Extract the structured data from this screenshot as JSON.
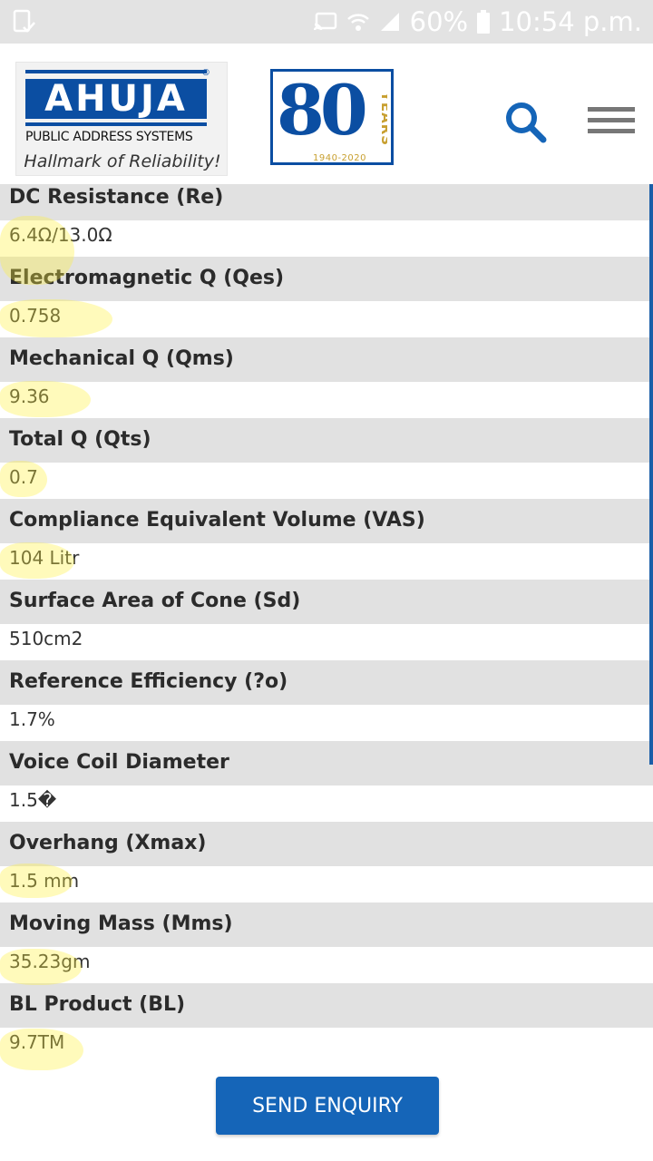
{
  "status_bar": {
    "battery": "60%",
    "time": "10:54 p.m."
  },
  "header": {
    "logo": {
      "name": "AHUJA",
      "registered": "®",
      "subtitle": "PUBLIC ADDRESS SYSTEMS",
      "tagline": "Hallmark of Reliability!"
    },
    "anniversary": {
      "number": "80",
      "word": "YEARS",
      "range": "1940-2020"
    },
    "icons": {
      "search": "search-icon",
      "menu": "hamburger-menu-icon"
    }
  },
  "colors": {
    "brand_blue": "#0b4ea2",
    "button_blue": "#1565b8",
    "label_bg": "#e1e1e1",
    "status_bg": "#e3e3e3",
    "highlight": "#fff03c"
  },
  "specs": [
    {
      "label": "DC Resistance (Re)",
      "value": "6.4Ω/13.0Ω"
    },
    {
      "label": "Electromagnetic Q (Qes)",
      "value": "0.758"
    },
    {
      "label": "Mechanical Q (Qms)",
      "value": "9.36"
    },
    {
      "label": "Total Q (Qts)",
      "value": "0.7"
    },
    {
      "label": "Compliance Equivalent Volume (VAS)",
      "value": "104 Litr"
    },
    {
      "label": "Surface Area of Cone (Sd)",
      "value": "510cm2"
    },
    {
      "label": "Reference Efficiency (?o)",
      "value": "1.7%"
    },
    {
      "label": "Voice Coil Diameter",
      "value": "1.5�"
    },
    {
      "label": "Overhang (Xmax)",
      "value": "1.5 mm"
    },
    {
      "label": "Moving Mass (Mms)",
      "value": "35.23gm"
    },
    {
      "label": "BL Product (BL)",
      "value": "9.7TM"
    }
  ],
  "send_button": "SEND ENQUIRY"
}
